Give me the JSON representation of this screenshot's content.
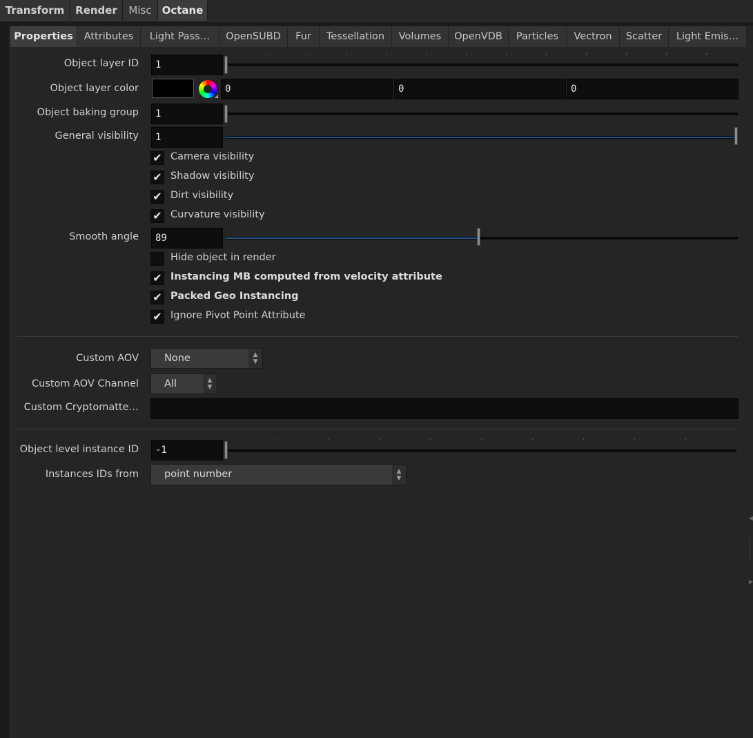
{
  "top_tabs": [
    {
      "label": "Transform"
    },
    {
      "label": "Render"
    },
    {
      "label": "Misc"
    },
    {
      "label": "Octane"
    }
  ],
  "sub_tabs": [
    {
      "label": "Properties"
    },
    {
      "label": "Attributes"
    },
    {
      "label": "Light Pass…"
    },
    {
      "label": "OpenSUBD"
    },
    {
      "label": "Fur"
    },
    {
      "label": "Tessellation"
    },
    {
      "label": "Volumes"
    },
    {
      "label": "OpenVDB"
    },
    {
      "label": "Particles"
    },
    {
      "label": "Vectron"
    },
    {
      "label": "Scatter"
    },
    {
      "label": "Light Emis…"
    }
  ],
  "params": {
    "object_layer_id": {
      "label": "Object layer ID",
      "value": "1",
      "slider_fraction": 0.0
    },
    "object_layer_color": {
      "label": "Object layer color",
      "r": "0",
      "g": "0",
      "b": "0",
      "swatch_color": "#000000"
    },
    "object_baking_group": {
      "label": "Object baking group",
      "value": "1",
      "slider_fraction": 0.0
    },
    "general_visibility": {
      "label": "General visibility",
      "value": "1",
      "slider_fraction": 1.0
    },
    "camera_visibility": {
      "label": "Camera visibility",
      "checked": true
    },
    "shadow_visibility": {
      "label": "Shadow visibility",
      "checked": true
    },
    "dirt_visibility": {
      "label": "Dirt visibility",
      "checked": true
    },
    "curvature_visibility": {
      "label": "Curvature visibility",
      "checked": true
    },
    "smooth_angle": {
      "label": "Smooth angle",
      "value": "89",
      "slider_fraction": 0.494
    },
    "hide_object_in_render": {
      "label": "Hide object in render",
      "checked": false
    },
    "instancing_mb": {
      "label": "Instancing MB computed from velocity attribute",
      "checked": true
    },
    "packed_geo_instancing": {
      "label": "Packed Geo Instancing",
      "checked": true
    },
    "ignore_pivot_point": {
      "label": "Ignore Pivot Point Attribute",
      "checked": true
    },
    "custom_aov": {
      "label": "Custom AOV",
      "value": "None"
    },
    "custom_aov_channel": {
      "label": "Custom AOV Channel",
      "value": "All"
    },
    "custom_cryptomatte": {
      "label": "Custom Cryptomatte…",
      "value": ""
    },
    "object_level_instance_id": {
      "label": "Object level instance ID",
      "value": "-1",
      "slider_fraction": 0.0
    },
    "instances_ids_from": {
      "label": "Instances IDs from",
      "value": "point number"
    }
  },
  "check_glyph": "✔",
  "colors": {
    "accent_fill": "#24538a",
    "background": "#252525"
  }
}
